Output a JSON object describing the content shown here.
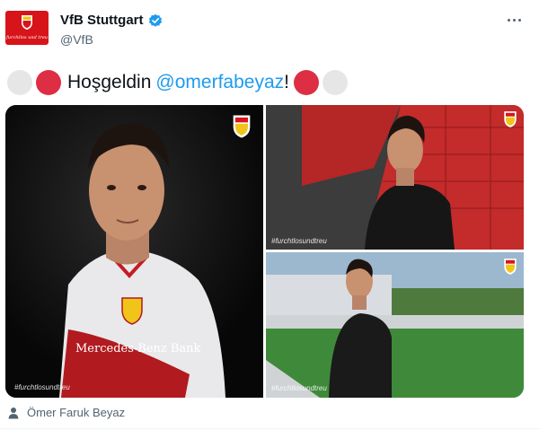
{
  "account": {
    "display_name": "VfB Stuttgart",
    "handle": "@VfB",
    "avatar_tagline": "furchtlos und treu",
    "verified": true
  },
  "tweet": {
    "text_before": "Hoşgeldin",
    "mention": "@omerfabeyaz",
    "text_after": "!",
    "emoji_left": [
      "white-circle",
      "red-circle"
    ],
    "emoji_right": [
      "red-circle",
      "white-circle"
    ]
  },
  "media": {
    "photos": [
      {
        "hashtag": "#furchtlosundtreu",
        "shirt_sponsor": "Mercedes-Benz Bank"
      },
      {
        "hashtag": "#furchtlosundtreu"
      },
      {
        "hashtag": "#furchtlosundtreu"
      }
    ]
  },
  "footer": {
    "tagged_person": "Ömer Faruk Beyaz"
  },
  "colors": {
    "club_red": "#d7141a",
    "link_blue": "#1d9bf0",
    "secondary_text": "#536471"
  }
}
